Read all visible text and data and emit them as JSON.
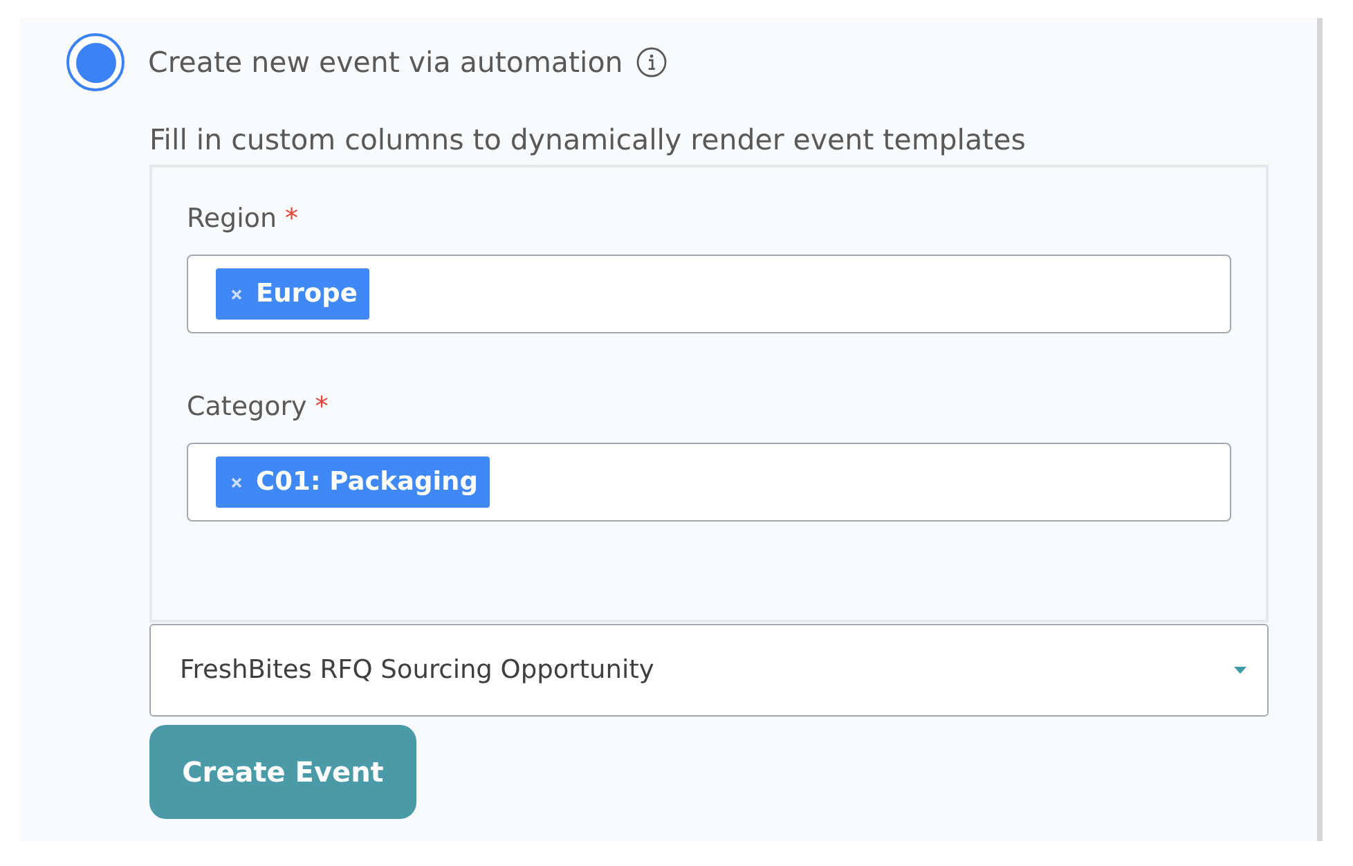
{
  "option": {
    "label": "Create new event via automation",
    "selected": true,
    "info_icon": true
  },
  "description": "Fill in custom columns to dynamically render event templates",
  "fields": [
    {
      "label": "Region",
      "required_mark": "*",
      "tags": [
        {
          "text": "Europe"
        }
      ]
    },
    {
      "label": "Category",
      "required_mark": "*",
      "tags": [
        {
          "text": "C01: Packaging"
        }
      ]
    }
  ],
  "template_select": {
    "value": "FreshBites RFQ Sourcing Opportunity"
  },
  "button": {
    "label": "Create Event"
  }
}
